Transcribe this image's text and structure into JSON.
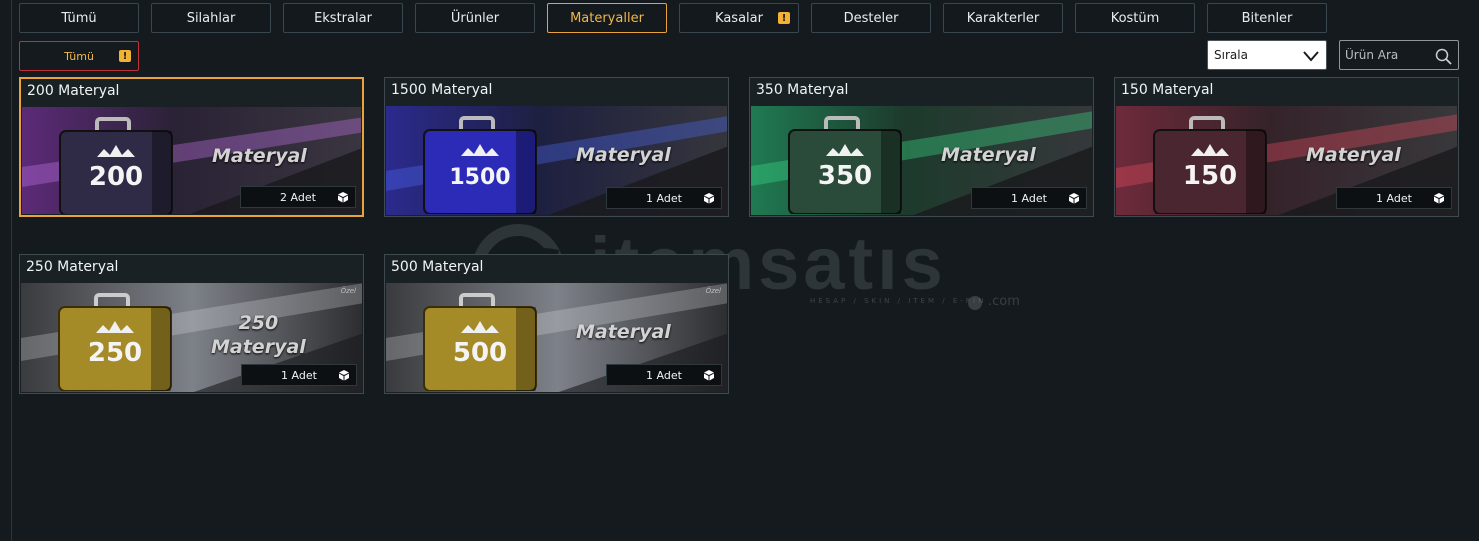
{
  "tabs": [
    {
      "label": "Tümü",
      "active": false,
      "warning": false
    },
    {
      "label": "Silahlar",
      "active": false,
      "warning": false
    },
    {
      "label": "Ekstralar",
      "active": false,
      "warning": false
    },
    {
      "label": "Ürünler",
      "active": false,
      "warning": false
    },
    {
      "label": "Materyaller",
      "active": true,
      "warning": false
    },
    {
      "label": "Kasalar",
      "active": false,
      "warning": true
    },
    {
      "label": "Desteler",
      "active": false,
      "warning": false
    },
    {
      "label": "Karakterler",
      "active": false,
      "warning": false
    },
    {
      "label": "Kostüm",
      "active": false,
      "warning": false
    },
    {
      "label": "Bitenler",
      "active": false,
      "warning": false
    }
  ],
  "filter": {
    "label": "Tümü",
    "warning_icon": "!"
  },
  "sort": {
    "label": "Sırala"
  },
  "search": {
    "placeholder": "Ürün Ara"
  },
  "watermark": {
    "word": "itemsatıs",
    "tagline": "HESAP / SKIN / ITEM / E-PIN",
    "suffix": ".com"
  },
  "items": [
    {
      "title": "200 Materyal",
      "number": "200",
      "banner": "Materyal",
      "qty": "2 Adet",
      "selected": true,
      "special": "",
      "theme": "purple",
      "case_color": "#2f2a45",
      "glow": "#a04fd0"
    },
    {
      "title": "1500 Materyal",
      "number": "1500",
      "banner": "Materyal",
      "qty": "1 Adet",
      "selected": false,
      "special": "",
      "theme": "blue",
      "case_color": "#2b2bb8",
      "glow": "#3a4ef0"
    },
    {
      "title": "350 Materyal",
      "number": "350",
      "banner": "Materyal",
      "qty": "1 Adet",
      "selected": false,
      "special": "",
      "theme": "green",
      "case_color": "#2a4a3a",
      "glow": "#2fd884"
    },
    {
      "title": "150 Materyal",
      "number": "150",
      "banner": "Materyal",
      "qty": "1 Adet",
      "selected": false,
      "special": "",
      "theme": "red",
      "case_color": "#4a2631",
      "glow": "#e0465a"
    },
    {
      "title": "250 Materyal",
      "number": "250",
      "banner_line1": "250",
      "banner_line2": "Materyal",
      "qty": "1 Adet",
      "selected": false,
      "special": "Özel",
      "theme": "gold",
      "case_color": "#a58a28",
      "glow": "#c8cbd0"
    },
    {
      "title": "500 Materyal",
      "number": "500",
      "banner": "Materyal",
      "qty": "1 Adet",
      "selected": false,
      "special": "Özel",
      "theme": "gold",
      "case_color": "#a58a28",
      "glow": "#c8cbd0"
    }
  ]
}
